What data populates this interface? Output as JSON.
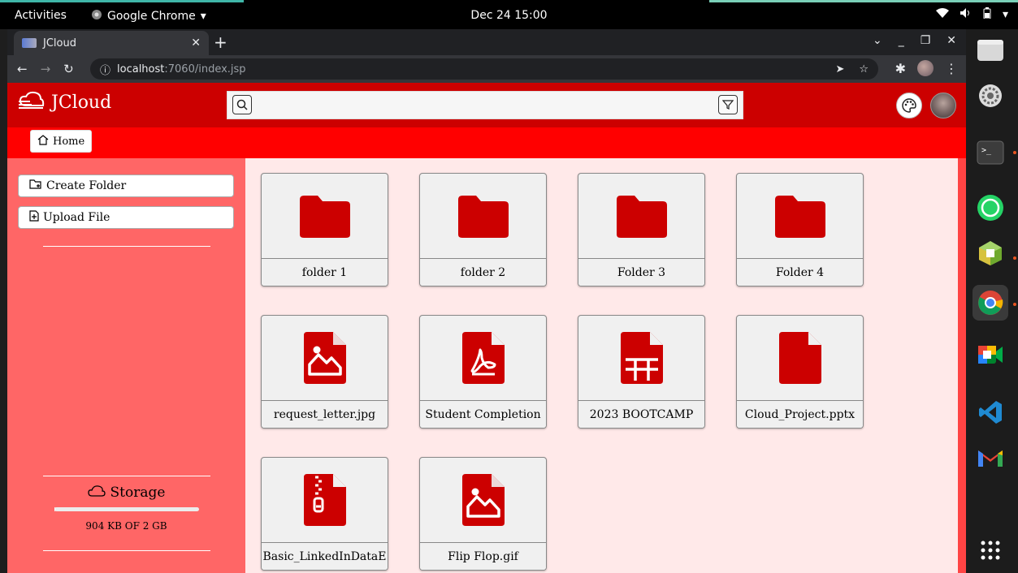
{
  "topbar": {
    "activities": "Activities",
    "app": "Google Chrome",
    "clock": "Dec 24  15:00"
  },
  "browser": {
    "tab_title": "JCloud",
    "url_host": "localhost",
    "url_path": ":7060/index.jsp"
  },
  "app": {
    "logo": "JCloud",
    "search": {
      "value": "",
      "placeholder": ""
    },
    "nav_home": "Home",
    "sidebar": {
      "create_folder": "Create Folder",
      "upload_file": "Upload File",
      "storage_title": "Storage",
      "storage_text": "904 KB OF 2 GB",
      "storage_used_fraction": 0.00043
    },
    "items": [
      {
        "name": "folder 1",
        "type": "folder"
      },
      {
        "name": "folder 2",
        "type": "folder"
      },
      {
        "name": "Folder 3",
        "type": "folder"
      },
      {
        "name": "Folder 4",
        "type": "folder"
      },
      {
        "name": "request_letter.jpg",
        "type": "image"
      },
      {
        "name": "Student Completion",
        "type": "pdf"
      },
      {
        "name": "2023 BOOTCAMP",
        "type": "spreadsheet"
      },
      {
        "name": "Cloud_Project.pptx",
        "type": "file"
      },
      {
        "name": "Basic_LinkedInDataE",
        "type": "zip"
      },
      {
        "name": "Flip Flop.gif",
        "type": "image"
      }
    ]
  },
  "colors": {
    "header": "#cc0000",
    "navbar": "#ff0000",
    "sidebar": "#ff6666",
    "content_bg": "#ffe9e9",
    "icon": "#cc0000"
  },
  "dock": [
    "files-icon",
    "settings-icon",
    "terminal-icon",
    "whatsapp-icon",
    "cube-app-icon",
    "chrome-icon",
    "meet-icon",
    "vscode-icon",
    "gmail-icon",
    "app-grid-icon"
  ]
}
